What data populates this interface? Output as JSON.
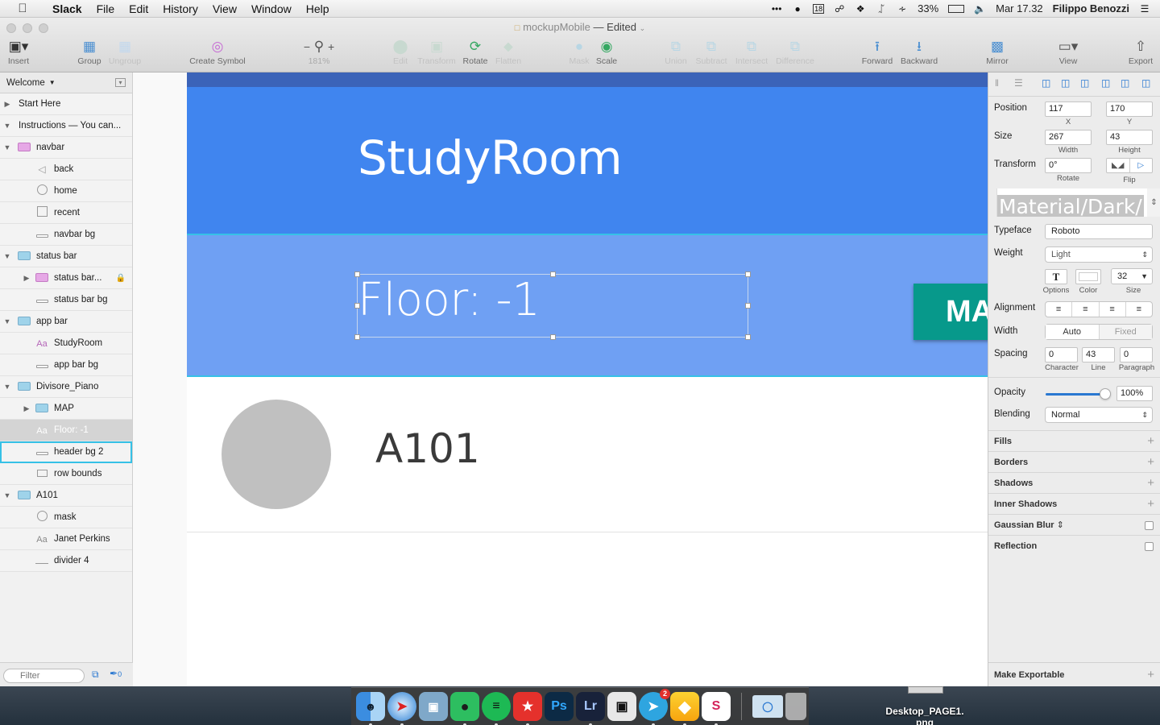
{
  "menubar": {
    "app": "Slack",
    "items": [
      "File",
      "Edit",
      "History",
      "View",
      "Window",
      "Help"
    ],
    "status": {
      "calendar_day": "18",
      "battery": "33%",
      "datetime": "Mar 17.32",
      "user": "Filippo Benozzi"
    }
  },
  "window": {
    "doc_title": "mockupMobile",
    "doc_state": "— Edited",
    "toolbar": {
      "insert": "Insert",
      "group": "Group",
      "ungroup": "Ungroup",
      "create_symbol": "Create Symbol",
      "zoom_minus": "−",
      "zoom_plus": "+",
      "zoom": "181%",
      "edit": "Edit",
      "transform": "Transform",
      "rotate": "Rotate",
      "flatten": "Flatten",
      "mask": "Mask",
      "scale": "Scale",
      "union": "Union",
      "subtract": "Subtract",
      "intersect": "Intersect",
      "difference": "Difference",
      "forward": "Forward",
      "backward": "Backward",
      "mirror": "Mirror",
      "view": "View",
      "export": "Export"
    }
  },
  "layers": {
    "page": "Welcome",
    "items": [
      {
        "label": "Start Here"
      },
      {
        "label": "Instructions — You can..."
      },
      {
        "label": "navbar"
      },
      {
        "label": "back"
      },
      {
        "label": "home"
      },
      {
        "label": "recent"
      },
      {
        "label": "navbar bg"
      },
      {
        "label": "status bar"
      },
      {
        "label": "status bar..."
      },
      {
        "label": "status bar bg"
      },
      {
        "label": "app bar"
      },
      {
        "label": "StudyRoom"
      },
      {
        "label": "app bar bg"
      },
      {
        "label": "Divisore_Piano"
      },
      {
        "label": "MAP"
      },
      {
        "label": "Floor: -1"
      },
      {
        "label": "header bg 2"
      },
      {
        "label": "row bounds"
      },
      {
        "label": "A101"
      },
      {
        "label": "mask"
      },
      {
        "label": "Janet Perkins"
      },
      {
        "label": "divider 4"
      }
    ],
    "filter_placeholder": "Filter",
    "slice_count": "0"
  },
  "canvas": {
    "app_title": "StudyRoom",
    "floor_label": "Floor: -1",
    "map_button": "MAP",
    "room_name": "A101"
  },
  "inspector": {
    "position_label": "Position",
    "x": "117",
    "y": "170",
    "x_sub": "X",
    "y_sub": "Y",
    "size_label": "Size",
    "width": "267",
    "height": "43",
    "width_sub": "Width",
    "height_sub": "Height",
    "transform_label": "Transform",
    "rotate": "0°",
    "rotate_sub": "Rotate",
    "flip_sub": "Flip",
    "text_style": "Material/Dark/",
    "typeface_label": "Typeface",
    "typeface": "Roboto",
    "weight_label": "Weight",
    "weight": "Light",
    "options_sub": "Options",
    "color_sub": "Color",
    "font_size": "32",
    "size_sub": "Size",
    "alignment_label": "Alignment",
    "width_mode_label": "Width",
    "width_auto": "Auto",
    "width_fixed": "Fixed",
    "spacing_label": "Spacing",
    "char_spacing": "0",
    "line_spacing": "43",
    "para_spacing": "0",
    "char_sub": "Character",
    "line_sub": "Line",
    "para_sub": "Paragraph",
    "opacity_label": "Opacity",
    "opacity": "100%",
    "opacity_value": 1.0,
    "blending_label": "Blending",
    "blending": "Normal",
    "fills": "Fills",
    "borders": "Borders",
    "shadows": "Shadows",
    "inner_shadows": "Inner Shadows",
    "gaussian_blur": "Gaussian Blur",
    "reflection": "Reflection",
    "make_exportable": "Make Exportable"
  },
  "dock": {
    "apps": [
      {
        "name": "Finder"
      },
      {
        "name": "Safari"
      },
      {
        "name": "Preview"
      },
      {
        "name": "Evernote"
      },
      {
        "name": "Spotify"
      },
      {
        "name": "Wunderlist"
      },
      {
        "name": "Photoshop",
        "text": "Ps"
      },
      {
        "name": "Lightroom",
        "text": "Lr"
      },
      {
        "name": "Unity"
      },
      {
        "name": "Telegram",
        "badge": "2"
      },
      {
        "name": "Sketch"
      },
      {
        "name": "Slack"
      },
      {
        "name": "Folder"
      },
      {
        "name": "Trash"
      }
    ]
  },
  "desktop": {
    "file_label": "Desktop_PAGE1.\npng"
  },
  "colors": {
    "app_bar": "#4085ef",
    "header_bg": "#6fa0f3",
    "status_bar": "#3b63b8",
    "map_button": "#07998b",
    "selection": "#36c1e6",
    "accent": "#2a78d1"
  }
}
